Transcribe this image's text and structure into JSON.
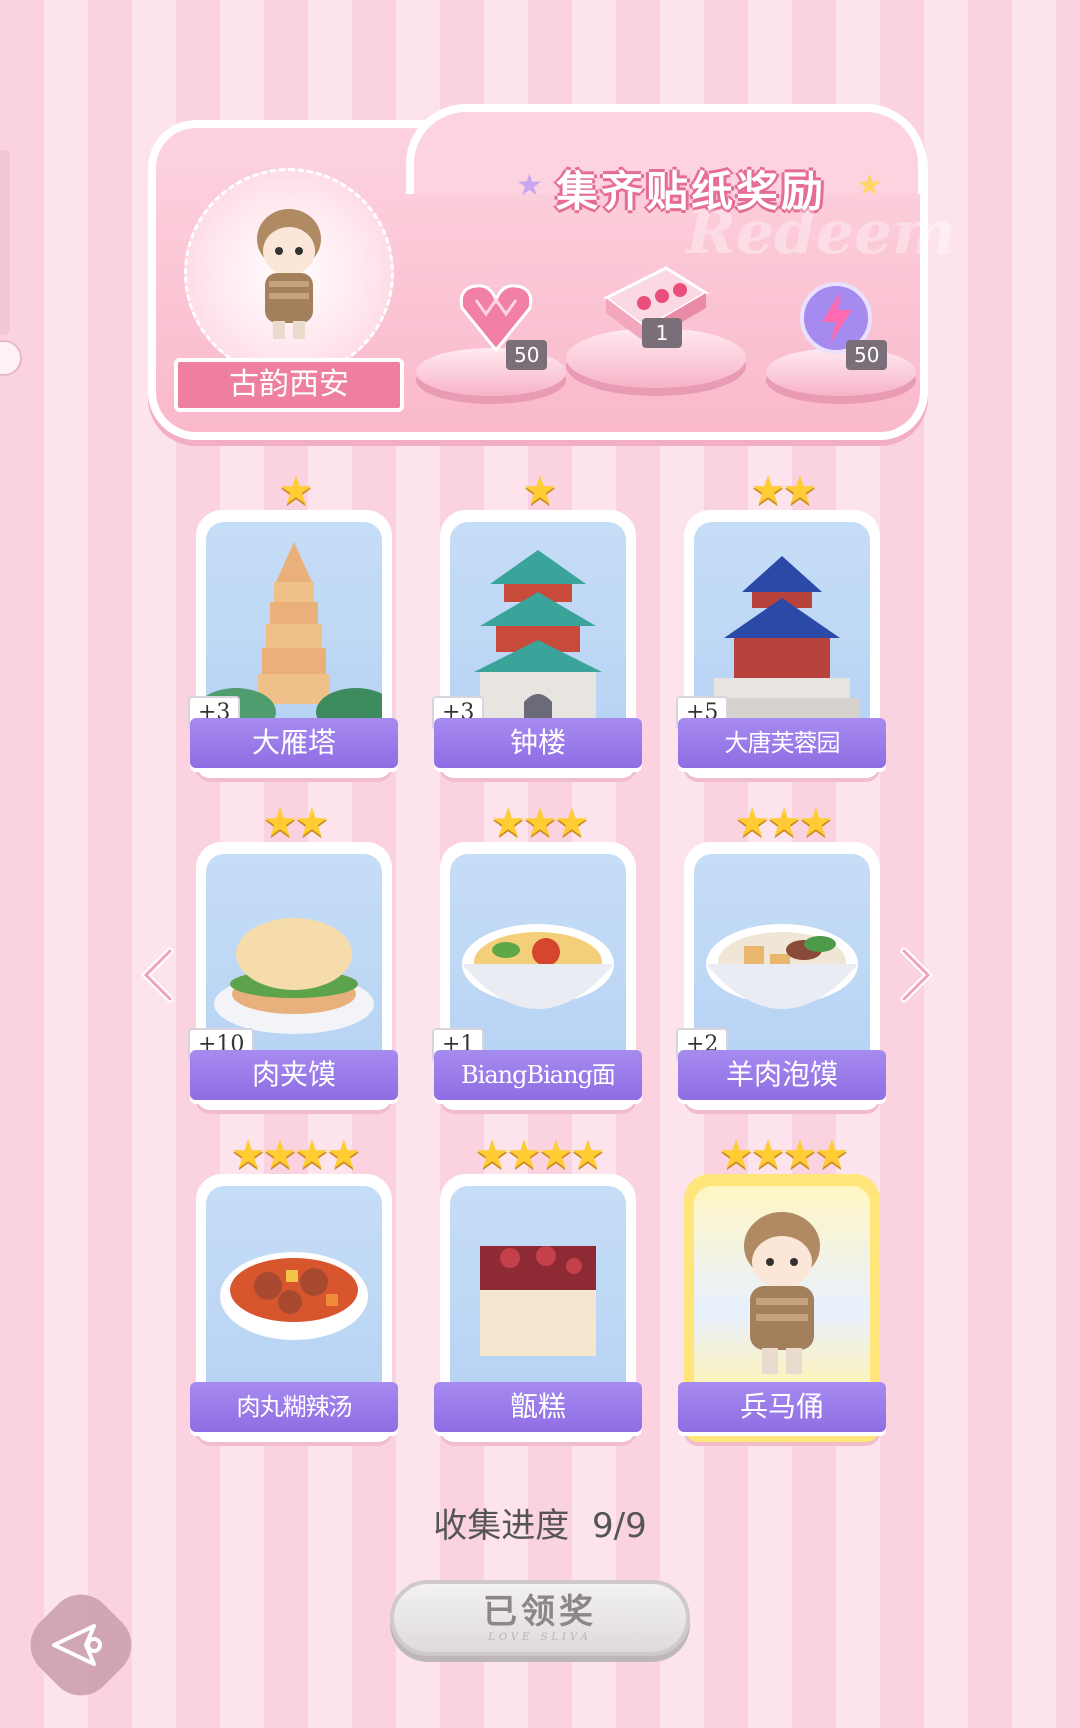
{
  "banner": {
    "title": "集齐贴纸奖励",
    "watermark": "Redeem",
    "character_name": "古韵西安",
    "rewards": [
      {
        "icon": "pink-heart-gem-icon",
        "count": "50"
      },
      {
        "icon": "gift-box-icon",
        "count": "1"
      },
      {
        "icon": "purple-lightning-orb-icon",
        "count": "50"
      }
    ]
  },
  "cards": [
    {
      "name": "大雁塔",
      "stars": "★",
      "bonus": "+3",
      "icon": "pagoda-icon"
    },
    {
      "name": "钟楼",
      "stars": "★",
      "bonus": "+3",
      "icon": "bell-tower-icon"
    },
    {
      "name": "大唐芙蓉园",
      "stars": "★★",
      "bonus": "+5",
      "icon": "temple-pavilion-icon"
    },
    {
      "name": "肉夹馍",
      "stars": "★★",
      "bonus": "+10",
      "icon": "roujiamo-icon"
    },
    {
      "name": "BiangBiang面",
      "stars": "★★★",
      "bonus": "+1",
      "icon": "noodle-bowl-icon"
    },
    {
      "name": "羊肉泡馍",
      "stars": "★★★",
      "bonus": "+2",
      "icon": "mutton-soup-icon"
    },
    {
      "name": "肉丸糊辣汤",
      "stars": "★★★★",
      "bonus": "",
      "icon": "meatball-soup-icon"
    },
    {
      "name": "甑糕",
      "stars": "★★★★",
      "bonus": "",
      "icon": "zenggao-cake-icon"
    },
    {
      "name": "兵马俑",
      "stars": "★★★★",
      "bonus": "",
      "icon": "terracotta-warrior-icon"
    }
  ],
  "progress": {
    "label": "收集进度",
    "value": "9/9"
  },
  "claim_button": {
    "label": "已领奖",
    "subtext": "LOVE SLIVA"
  },
  "colors": {
    "label_purple": "#9a7be9",
    "banner_pink": "#f9b9cb",
    "star_gold": "#ffcc33"
  }
}
